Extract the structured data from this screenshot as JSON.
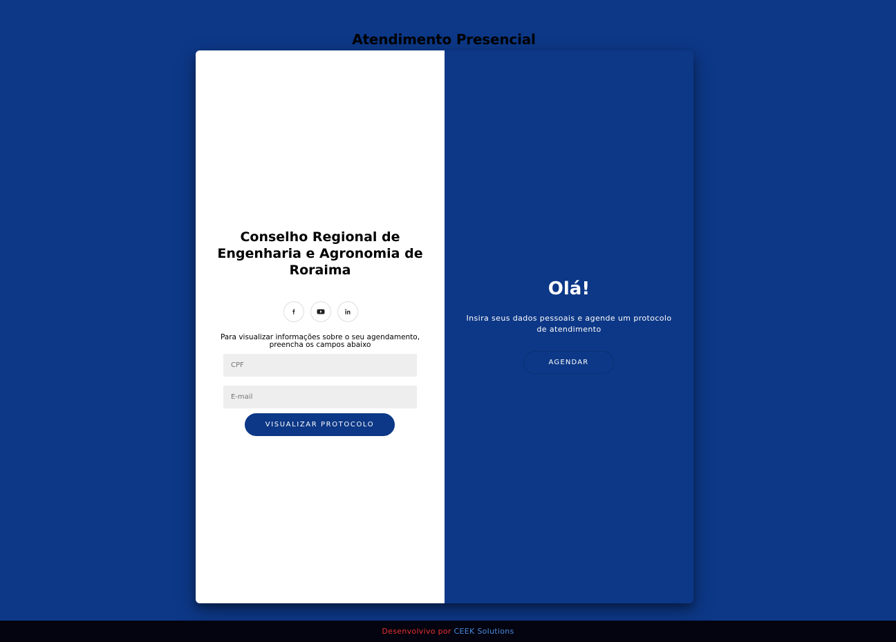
{
  "page": {
    "title": "Atendimento Presencial"
  },
  "left_panel": {
    "org_name": "Conselho Regional de Engenharia e Agronomia de Roraima",
    "social": [
      {
        "icon": "facebook-icon"
      },
      {
        "icon": "youtube-icon"
      },
      {
        "icon": "linkedin-icon"
      }
    ],
    "instructions": "Para visualizar informações sobre o seu agendamento, preencha os campos abaixo",
    "cpf_placeholder": "CPF",
    "email_placeholder": "E-mail",
    "submit_label": "VISUALIZAR PROTOCOLO"
  },
  "right_panel": {
    "greeting": "Olá!",
    "subtitle": "Insira seus dados pessoais e agende um protocolo de atendimento",
    "button_label": "AGENDAR"
  },
  "footer": {
    "prefix": "Desenvolvivo por",
    "link_text": "CEEK Solutions"
  },
  "colors": {
    "background": "#0d3887",
    "primary": "#0d3887",
    "footer_bg": "#03040f",
    "footer_prefix": "#e8302e",
    "footer_link": "#4b8be0",
    "input_bg": "#eeeeee"
  }
}
